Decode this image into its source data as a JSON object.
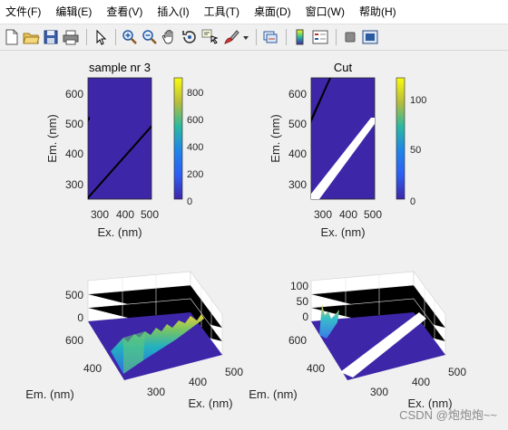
{
  "menus": [
    "文件(F)",
    "编辑(E)",
    "查看(V)",
    "插入(I)",
    "工具(T)",
    "桌面(D)",
    "窗口(W)",
    "帮助(H)"
  ],
  "toolbar": {
    "icons": [
      "new-figure-icon",
      "open-file-icon",
      "save-icon",
      "print-icon",
      "pointer-icon",
      "zoom-in-icon",
      "zoom-out-icon",
      "pan-hand-icon",
      "rotate-3d-icon",
      "data-cursor-icon",
      "brush-icon",
      "brush-dropdown-icon",
      "link-plot-icon",
      "colorbar-icon",
      "legend-icon",
      "hide-plot-tools-icon",
      "show-plot-tools-icon"
    ]
  },
  "colors": {
    "background": "#f0f0f0",
    "axes_fill": "#3e26a8",
    "colormap_top": "#f9fb0e",
    "colormap_mid": "#2bb9a0",
    "colormap_low": "#1f85ea"
  },
  "plots": {
    "p1": {
      "title": "sample nr 3",
      "xlabel": "Ex. (nm)",
      "ylabel": "Em. (nm)",
      "xticks": [
        "300",
        "400",
        "500"
      ],
      "yticks": [
        "600",
        "500",
        "400",
        "300"
      ],
      "colorbar_ticks": [
        "800",
        "600",
        "400",
        "200",
        "0"
      ]
    },
    "p2": {
      "title": "Cut",
      "xlabel": "Ex. (nm)",
      "ylabel": "Em. (nm)",
      "xticks": [
        "300",
        "400",
        "500"
      ],
      "yticks": [
        "600",
        "500",
        "400",
        "300"
      ],
      "colorbar_ticks": [
        "100",
        "50",
        "0"
      ]
    },
    "p3": {
      "zticks": [
        "500",
        "0"
      ],
      "yticks": [
        "600",
        "400"
      ],
      "xticks": [
        "300",
        "400",
        "500"
      ],
      "ylabel": "Em. (nm)",
      "xlabel": "Ex. (nm)"
    },
    "p4": {
      "zticks": [
        "100",
        "50",
        "0"
      ],
      "yticks": [
        "600",
        "400"
      ],
      "xticks": [
        "300",
        "400",
        "500"
      ],
      "ylabel": "Em. (nm)",
      "xlabel": "Ex. (nm)"
    }
  },
  "watermark": "CSDN @炮炮炮~~"
}
